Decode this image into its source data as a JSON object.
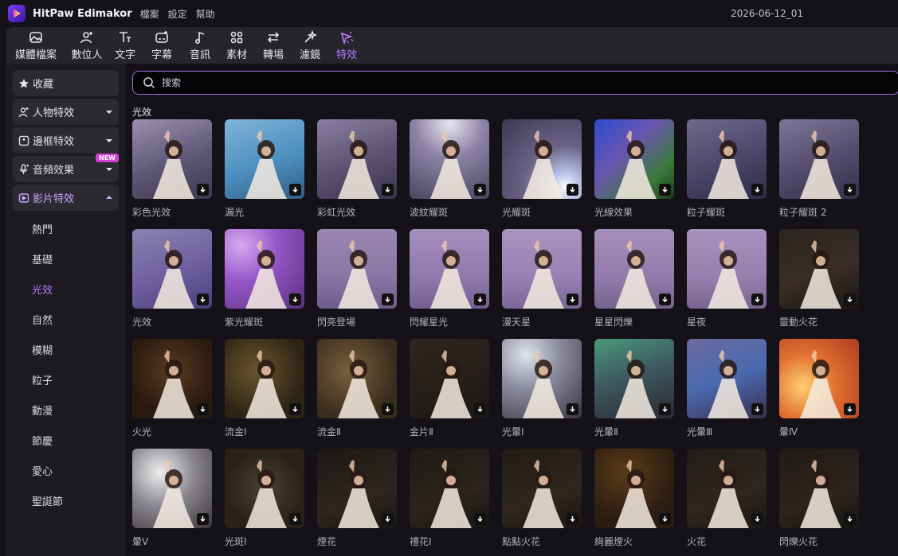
{
  "app": {
    "name": "HitPaw Edimakor",
    "project_name": "2026-06-12_01"
  },
  "menu": [
    "檔案",
    "設定",
    "幫助"
  ],
  "toolbar": [
    {
      "label": "媒體檔案",
      "icon": "media-icon"
    },
    {
      "label": "數位人",
      "icon": "avatar-add-icon"
    },
    {
      "label": "文字",
      "icon": "text-icon"
    },
    {
      "label": "字幕",
      "icon": "subtitle-icon"
    },
    {
      "label": "音訊",
      "icon": "music-icon"
    },
    {
      "label": "素材",
      "icon": "elements-icon"
    },
    {
      "label": "轉場",
      "icon": "transition-icon"
    },
    {
      "label": "濾鏡",
      "icon": "filter-icon"
    },
    {
      "label": "特效",
      "icon": "effects-icon",
      "active": true
    }
  ],
  "sidebar": {
    "items": [
      {
        "label": "收藏",
        "icon": "star-icon"
      },
      {
        "label": "人物特效",
        "icon": "person-icon",
        "expandable": true
      },
      {
        "label": "邊框特效",
        "icon": "frame-icon",
        "expandable": true
      },
      {
        "label": "音頻效果",
        "icon": "mic-icon",
        "expandable": true,
        "badge": "NEW"
      },
      {
        "label": "影片特效",
        "icon": "video-icon",
        "expandable": true,
        "open": true
      }
    ],
    "sub_items": [
      "熱門",
      "基礎",
      "光效",
      "自然",
      "模糊",
      "粒子",
      "動漫",
      "節慶",
      "愛心",
      "聖誕節"
    ],
    "active_sub": "光效"
  },
  "search": {
    "placeholder": "搜索"
  },
  "section": {
    "title": "光效"
  },
  "effects": [
    {
      "name": "彩色光效"
    },
    {
      "name": "漏光"
    },
    {
      "name": "彩虹光效"
    },
    {
      "name": "波紋耀斑"
    },
    {
      "name": "光耀斑"
    },
    {
      "name": "光線效果"
    },
    {
      "name": "粒子耀斑"
    },
    {
      "name": "粒子耀斑 2"
    },
    {
      "name": "光效"
    },
    {
      "name": "紫光耀斑"
    },
    {
      "name": "閃亮登場"
    },
    {
      "name": "閃耀星光"
    },
    {
      "name": "漫天星"
    },
    {
      "name": "星星閃爍"
    },
    {
      "name": "星夜"
    },
    {
      "name": "靈動火花"
    },
    {
      "name": "火光"
    },
    {
      "name": "流金Ⅰ"
    },
    {
      "name": "流金Ⅱ"
    },
    {
      "name": "金片Ⅱ"
    },
    {
      "name": "光暈Ⅰ"
    },
    {
      "name": "光暈Ⅱ"
    },
    {
      "name": "光暈Ⅲ"
    },
    {
      "name": "暈Ⅳ"
    },
    {
      "name": "暈Ⅴ"
    },
    {
      "name": "光斑Ⅰ"
    },
    {
      "name": "煙花"
    },
    {
      "name": "禮花Ⅰ"
    },
    {
      "name": "點點火花"
    },
    {
      "name": "絢麗煙火"
    },
    {
      "name": "火花"
    },
    {
      "name": "閃爍火花"
    }
  ],
  "colors": {
    "accent": "#b57bff",
    "search_border": "#a070e0",
    "badge": "#d43dd8"
  }
}
